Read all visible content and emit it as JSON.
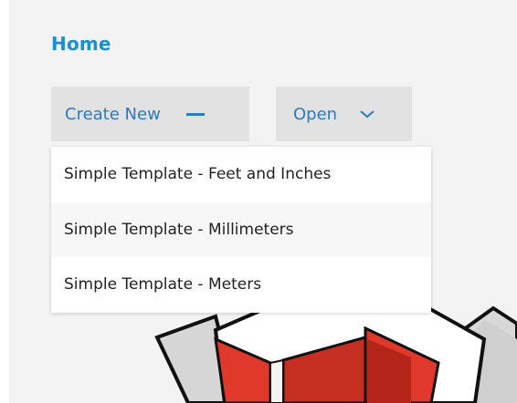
{
  "page": {
    "title": "Home"
  },
  "toolbar": {
    "create_new_label": "Create New",
    "open_label": "Open"
  },
  "menu": {
    "items": [
      {
        "label": "Simple Template - Feet and Inches"
      },
      {
        "label": "Simple Template - Millimeters"
      },
      {
        "label": "Simple Template - Meters"
      }
    ]
  },
  "colors": {
    "accent": "#1a8fd1",
    "link": "#2a7bbf",
    "panel_bg": "#f3f3f3",
    "button_bg": "#e2e2e2",
    "model_red": "#e0392c"
  },
  "icons": {
    "create_new": "minus-icon",
    "open": "chevron-down-icon"
  }
}
